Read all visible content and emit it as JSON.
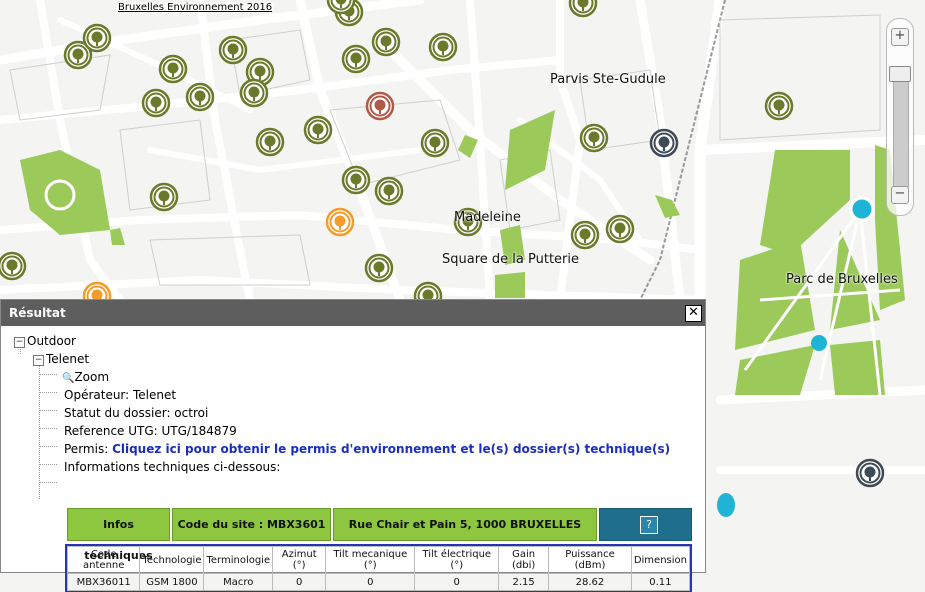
{
  "map": {
    "copyright": "Bruxelles Environnement 2016",
    "labels": [
      {
        "id": "parvis",
        "text": "Parvis Ste-Gudule"
      },
      {
        "id": "madeleine",
        "text": "Madeleine"
      },
      {
        "id": "putterie",
        "text": "Square de la Putterie"
      },
      {
        "id": "parc",
        "text": "Parc de Bruxelles"
      }
    ],
    "colors": {
      "park": "#9bc95a",
      "road": "#ffffff",
      "block": "#f4f4f2",
      "antenna_green": "#6b7a2a",
      "antenna_orange": "#f39c2c",
      "antenna_red": "#b05a4a",
      "antenna_dark": "#3e4a54",
      "water": "#1fb4d6"
    },
    "zoom": {
      "plus": "+",
      "minus": "−"
    }
  },
  "panel": {
    "title": "Résultat",
    "close": "✕",
    "tree": {
      "outdoor": "Outdoor",
      "telenet": "Telenet",
      "zoom": "Zoom",
      "operateur": "Opérateur: Telenet",
      "statut": "Statut du dossier: octroi",
      "reference": "Reference UTG: UTG/184879",
      "permis_label": "Permis:",
      "permis_link": "Cliquez ici pour obtenir le permis d'environnement et le(s) dossier(s) technique(s)",
      "info": "Informations techniques ci-dessous:"
    },
    "site_bar": {
      "infos": "Infos techniques",
      "code_site": "Code du site : MBX3601",
      "address": "Rue Chair et Pain 5, 1000 BRUXELLES",
      "help": "?"
    },
    "table": {
      "headers": [
        "Code antenne",
        "Technologie",
        "Terminologie",
        "Azimut (°)",
        "Tilt mecanique (°)",
        "Tilt électrique (°)",
        "Gain (dbi)",
        "Puissance (dBm)",
        "Dimension"
      ],
      "rows": [
        [
          "MBX36011",
          "GSM 1800",
          "Macro",
          "0",
          "0",
          "0",
          "2.15",
          "28.62",
          "0.11"
        ]
      ]
    }
  }
}
